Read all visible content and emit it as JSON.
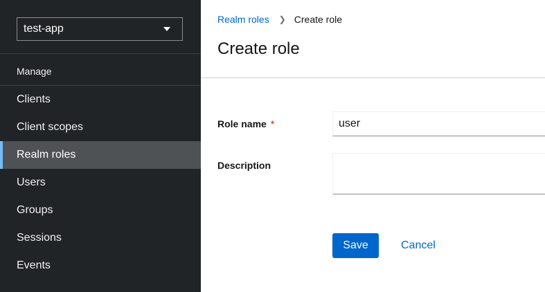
{
  "sidebar": {
    "realm_selector": {
      "value": "test-app"
    },
    "section_title": "Manage",
    "items": [
      {
        "label": "Clients"
      },
      {
        "label": "Client scopes"
      },
      {
        "label": "Realm roles",
        "active": true
      },
      {
        "label": "Users"
      },
      {
        "label": "Groups"
      },
      {
        "label": "Sessions"
      },
      {
        "label": "Events"
      }
    ]
  },
  "breadcrumb": {
    "parent": "Realm roles",
    "current": "Create role"
  },
  "page": {
    "title": "Create role"
  },
  "form": {
    "role_name": {
      "label": "Role name",
      "required_marker": "*",
      "value": "user"
    },
    "description": {
      "label": "Description",
      "value": ""
    }
  },
  "actions": {
    "save_label": "Save",
    "cancel_label": "Cancel"
  },
  "colors": {
    "accent": "#0066cc",
    "sidebar_bg": "#212427",
    "active_indicator": "#73bcf7",
    "required": "#c9190b"
  }
}
